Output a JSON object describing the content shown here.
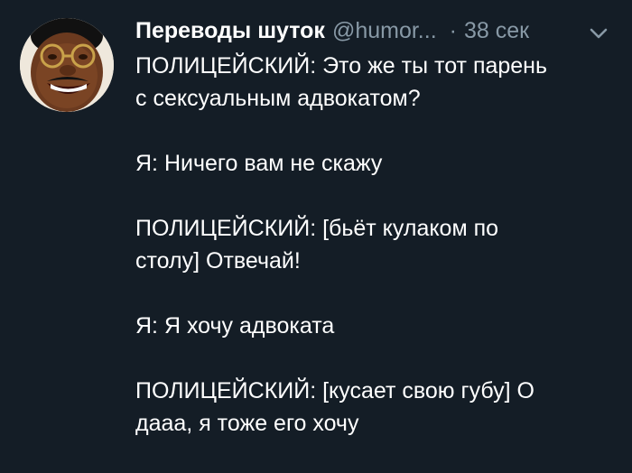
{
  "tweet": {
    "display_name": "Переводы шуток",
    "handle": "@humor...",
    "separator": "·",
    "time": "38 сек",
    "avatar_icon": "profile-photo",
    "menu_icon": "chevron-down-icon",
    "text_color": "#ffffff",
    "muted_color": "#8899a6",
    "background_color": "#141d26",
    "lines": [
      "ПОЛИЦЕЙСКИЙ: Это же ты тот парень",
      "с сексуальным адвокатом?",
      "",
      "Я: Ничего вам не скажу",
      "",
      "ПОЛИЦЕЙСКИЙ: [бьёт кулаком по",
      "столу] Отвечай!",
      "",
      "Я: Я хочу адвоката",
      "",
      "ПОЛИЦЕЙСКИЙ: [кусает свою губу] О",
      "дааа, я тоже его хочу"
    ]
  }
}
